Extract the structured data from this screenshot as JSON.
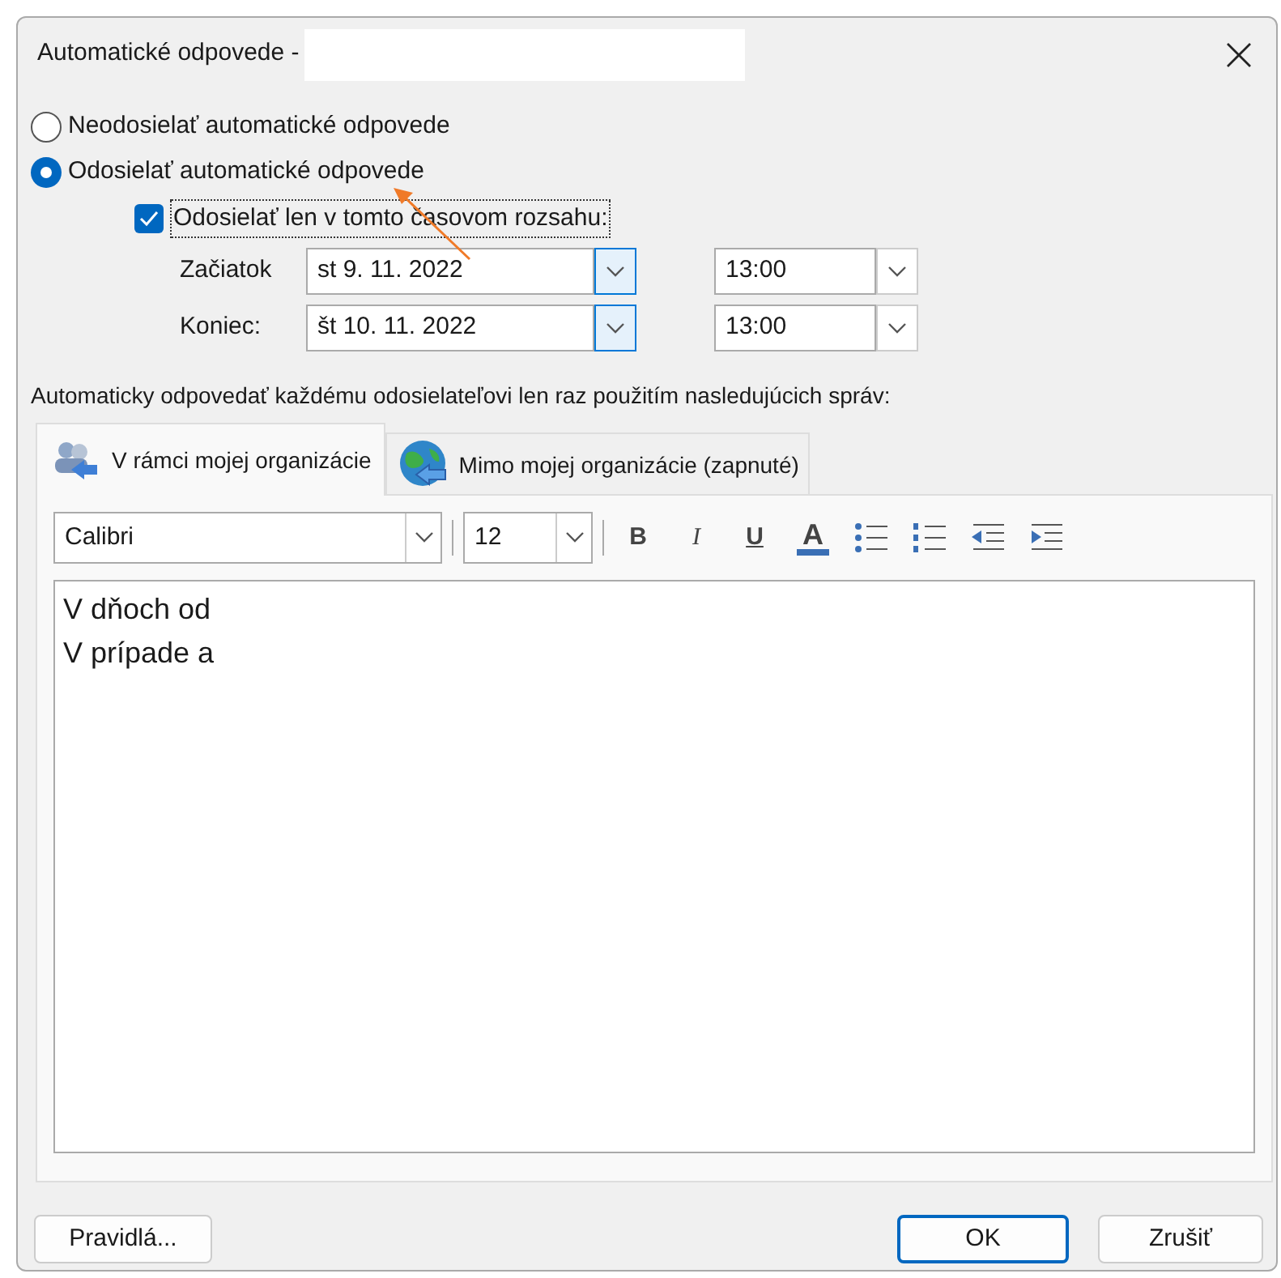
{
  "window": {
    "title": "Automatické odpovede -"
  },
  "options": [
    {
      "label": "Neodosielať automatické odpovede",
      "selected": false
    },
    {
      "label": "Odosielať automatické odpovede",
      "selected": true
    }
  ],
  "range": {
    "label": "Odosielať len v tomto časovom rozsahu:",
    "checked": true
  },
  "times": [
    {
      "label": "Začiatok",
      "date": "st 9. 11. 2022",
      "time": "13:00"
    },
    {
      "label": "Koniec:",
      "date": "št 10. 11. 2022",
      "time": "13:00"
    }
  ],
  "instruction": "Automaticky odpovedať každému odosielateľovi len raz použitím nasledujúcich správ:",
  "tabs": [
    {
      "label": "V rámci mojej organizácie",
      "kind": "people",
      "selected": true
    },
    {
      "label": "Mimo mojej organizácie (zapnuté)",
      "kind": "globe",
      "selected": false
    }
  ],
  "toolbar": {
    "font": "Calibri",
    "size": "12",
    "bold": "B",
    "italic": "I",
    "underline": "U",
    "font_color_letter": "A"
  },
  "message": [
    "V dňoch od",
    "V prípade a"
  ],
  "buttons": {
    "rules": "Pravidlá...",
    "ok": "OK",
    "cancel": "Zrušiť"
  }
}
